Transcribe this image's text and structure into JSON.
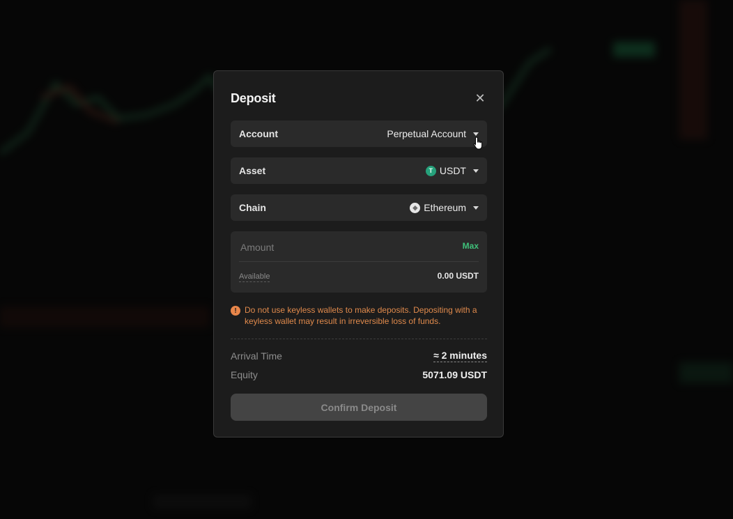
{
  "modal": {
    "title": "Deposit",
    "close_icon": "close-icon"
  },
  "fields": {
    "account": {
      "label": "Account",
      "value": "Perpetual Account"
    },
    "asset": {
      "label": "Asset",
      "value": "USDT",
      "icon": "usdt-coin-icon",
      "icon_glyph": "T",
      "icon_color": "#26a17b"
    },
    "chain": {
      "label": "Chain",
      "value": "Ethereum",
      "icon": "ethereum-icon",
      "icon_glyph": "◆"
    }
  },
  "amount": {
    "placeholder": "Amount",
    "value": "",
    "max_label": "Max",
    "available_label": "Available",
    "available_value": "0.00 USDT"
  },
  "warning": {
    "icon": "warning-icon",
    "icon_glyph": "!",
    "text": "Do not use keyless wallets to make deposits. Depositing with a keyless wallet may result in irreversible loss of funds."
  },
  "summary": {
    "arrival_label": "Arrival Time",
    "arrival_value": "≈ 2 minutes",
    "equity_label": "Equity",
    "equity_value": "5071.09 USDT"
  },
  "actions": {
    "confirm_label": "Confirm Deposit"
  },
  "colors": {
    "accent_green": "#3fc07a",
    "warning_orange": "#e08a4c",
    "modal_bg": "#1c1c1c",
    "field_bg": "#2a2a2a"
  }
}
